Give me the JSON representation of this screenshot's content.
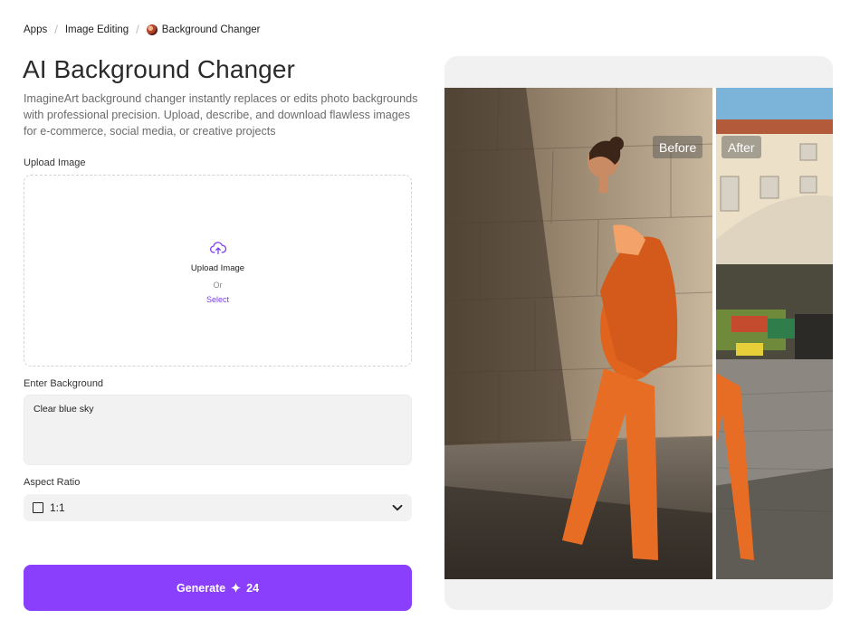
{
  "breadcrumb": {
    "items": [
      "Apps",
      "Image Editing",
      "Background Changer"
    ],
    "separator": "/"
  },
  "page": {
    "title": "AI Background Changer",
    "description": "ImagineArt background changer instantly replaces or edits photo backgrounds with professional precision. Upload, describe, and download flawless images for e-commerce, social media, or creative projects"
  },
  "upload": {
    "label": "Upload Image",
    "title": "Upload Image",
    "or_text": "Or",
    "select_text": "Select",
    "icon": "cloud-upload-icon"
  },
  "background": {
    "label": "Enter Background",
    "value": "Clear blue sky"
  },
  "aspect": {
    "label": "Aspect Ratio",
    "value": "1:1",
    "icon": "square-ratio-icon"
  },
  "generate": {
    "label": "Generate",
    "credits": "24",
    "icon": "sparkle-icon"
  },
  "preview": {
    "before_label": "Before",
    "after_label": "After"
  },
  "colors": {
    "accent": "#8a3ffc",
    "select_link": "#7c3aed",
    "field_bg": "#f2f2f2",
    "preview_bg": "#f1f1f1"
  }
}
